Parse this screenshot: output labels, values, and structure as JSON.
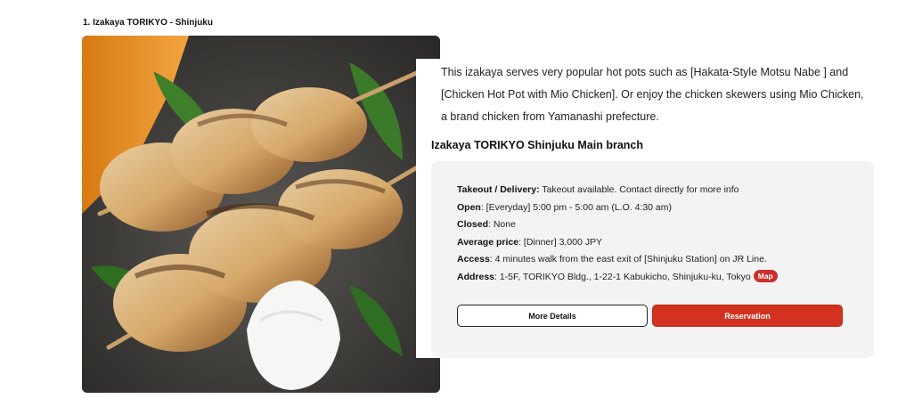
{
  "listing": {
    "title": "1. Izakaya TORIKYO - Shinjuku",
    "description": "This izakaya serves very popular hot pots such as [Hakata-Style Motsu Nabe ] and [Chicken Hot Pot with Mio Chicken]. Or enjoy the chicken skewers using Mio Chicken, a brand chicken from Yamanashi prefecture.",
    "branch_name": "Izakaya TORIKYO Shinjuku Main branch"
  },
  "info": {
    "takeout_label": "Takeout / Delivery:",
    "takeout_value": " Takeout available. Contact directly for more info",
    "open_label": "Open",
    "open_value": ": [Everyday] 5:00 pm - 5:00 am (L.O. 4:30 am)",
    "closed_label": "Closed",
    "closed_value": ": None",
    "price_label": "Average price",
    "price_value": ": [Dinner] 3,000 JPY",
    "access_label": "Access",
    "access_value": ": 4 minutes walk from the east exit of [Shinjuku Station] on JR Line.",
    "address_label": "Address",
    "address_value": ": 1-5F, TORIKYO Bldg., 1-22-1 Kabukicho, Shinjuku-ku, Tokyo",
    "map_label": "Map"
  },
  "buttons": {
    "details_label": "More Details",
    "reservation_label": "Reservation"
  },
  "colors": {
    "accent_red": "#d2321f",
    "info_bg": "#f3f3f3"
  }
}
